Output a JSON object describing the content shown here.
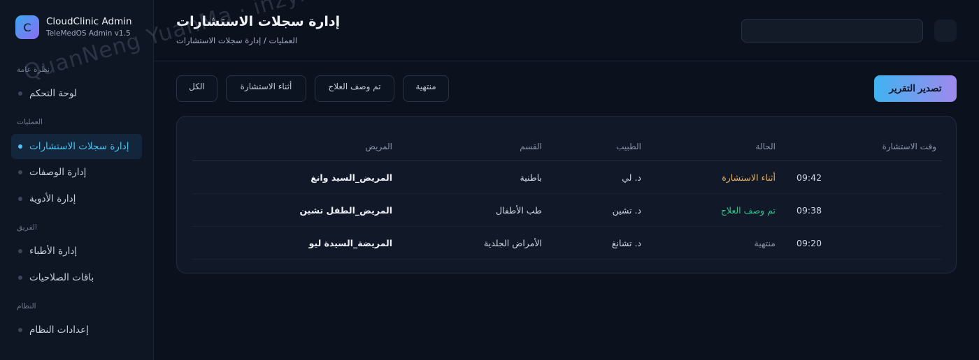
{
  "brand": {
    "logo_letter": "C",
    "name": "CloudClinic Admin",
    "version": "TeleMedOS Admin v1.5"
  },
  "sidebar": {
    "sections": [
      {
        "title": "نظرة عامة",
        "items": [
          {
            "label": "لوحة التحكم"
          }
        ]
      },
      {
        "title": "العمليات",
        "items": [
          {
            "label": "إدارة سجلات الاستشارات",
            "active": true
          },
          {
            "label": "إدارة الوصفات"
          },
          {
            "label": "إدارة الأدوية"
          }
        ]
      },
      {
        "title": "الفريق",
        "items": [
          {
            "label": "إدارة الأطباء"
          },
          {
            "label": "باقات الصلاحيات"
          }
        ]
      },
      {
        "title": "النظام",
        "items": [
          {
            "label": "إعدادات النظام"
          }
        ]
      }
    ]
  },
  "header": {
    "title": "إدارة سجلات الاستشارات",
    "breadcrumb": "العمليات / إدارة سجلات الاستشارات"
  },
  "filters": [
    "الكل",
    "أثناء الاستشارة",
    "تم وصف العلاج",
    "منتهية"
  ],
  "export_label": "تصدير التقرير",
  "table": {
    "headers": {
      "patient": "المريض",
      "department": "القسم",
      "doctor": "الطبيب",
      "status": "الحالة",
      "time": "وقت الاستشارة"
    },
    "rows": [
      {
        "patient": "المريض_السيد وانغ",
        "department": "باطنية",
        "doctor": "د. لي",
        "status": "أثناء الاستشارة",
        "status_color": "#e8b15a",
        "time": "09:42"
      },
      {
        "patient": "المريض_الطفل تشين",
        "department": "طب الأطفال",
        "doctor": "د. تشين",
        "status": "تم وصف العلاج",
        "status_color": "#35c28f",
        "time": "09:38"
      },
      {
        "patient": "المريضة_السيدة ليو",
        "department": "الأمراض الجلدية",
        "doctor": "د. تشانغ",
        "status": "منتهية",
        "status_color": "#8c96a8",
        "time": "09:20"
      }
    ]
  },
  "watermark": "QuanNeng YuanMa · inzyxuashop.com",
  "colors": {
    "background": "#0b111d",
    "sidebar": "#0e1523",
    "accent": "#4cc3f2",
    "export_gradient_start": "#40b3f0",
    "export_gradient_end": "#9f89ee"
  }
}
